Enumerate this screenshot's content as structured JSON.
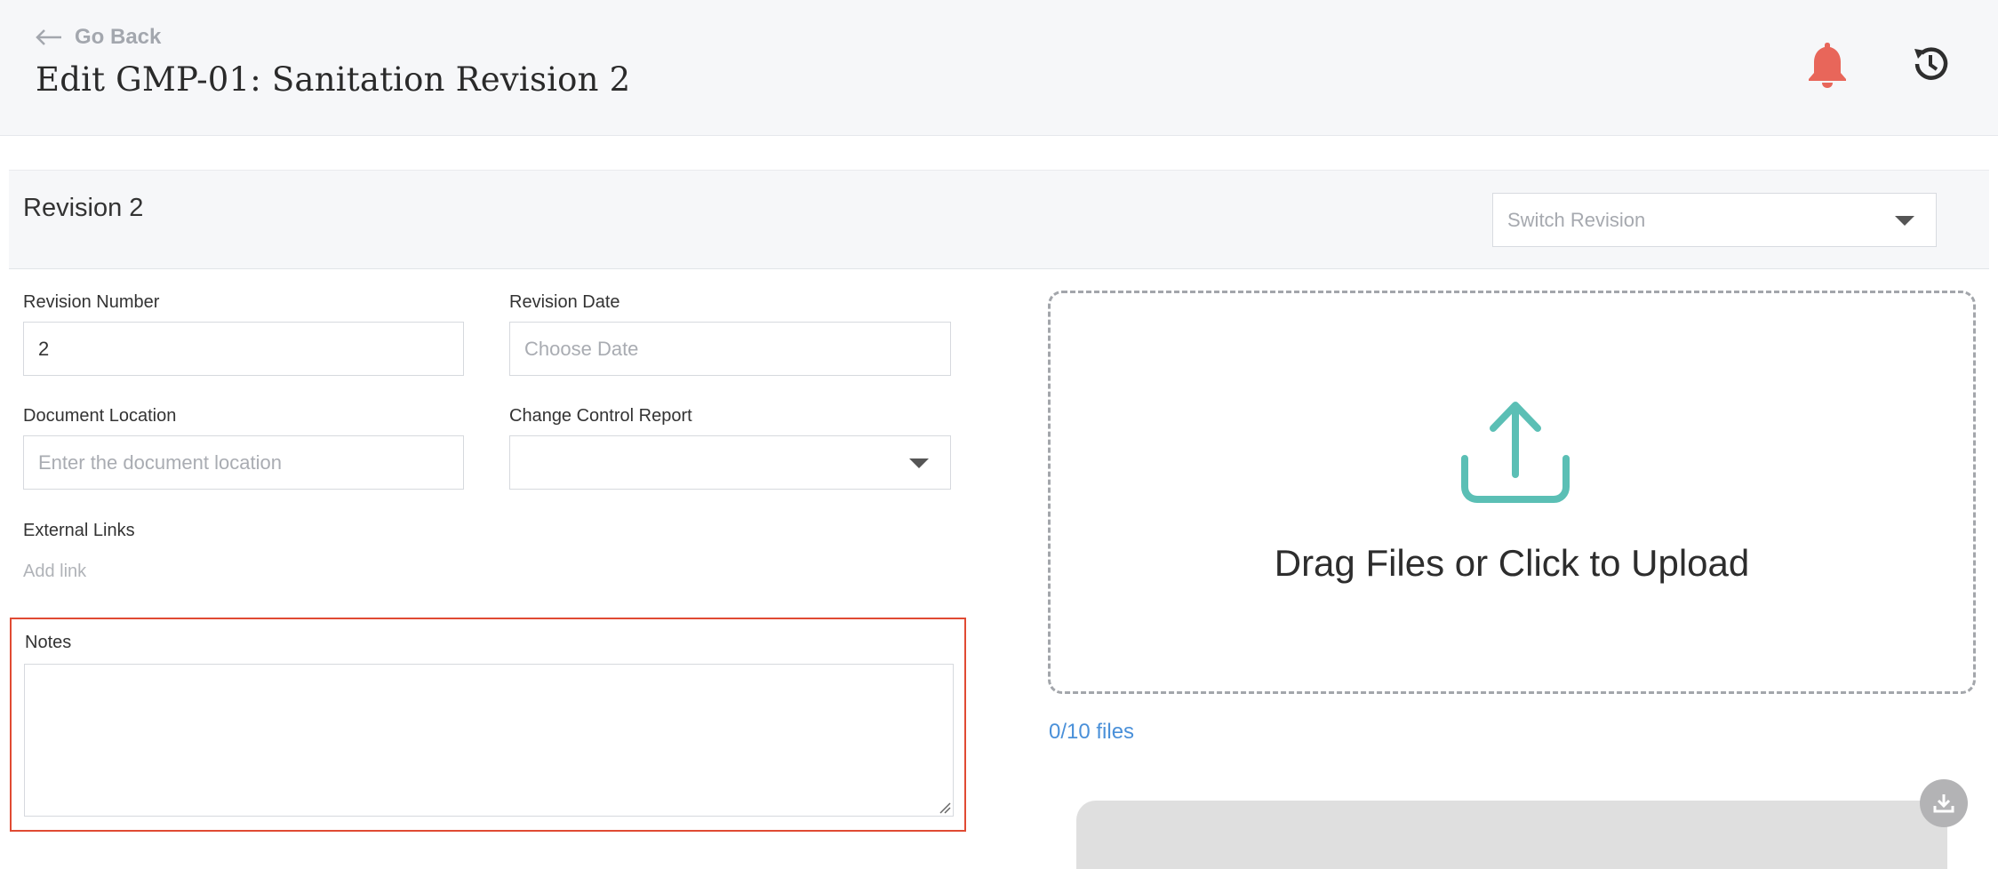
{
  "header": {
    "go_back_label": "Go Back",
    "title": "Edit GMP-01: Sanitation Revision 2",
    "bell_color": "#e8665a"
  },
  "revision": {
    "title": "Revision 2",
    "switch_placeholder": "Switch Revision"
  },
  "form": {
    "revision_number_label": "Revision Number",
    "revision_number_value": "2",
    "revision_date_label": "Revision Date",
    "revision_date_placeholder": "Choose Date",
    "document_location_label": "Document Location",
    "document_location_placeholder": "Enter the document location",
    "change_control_label": "Change Control Report",
    "change_control_value": "",
    "external_links_label": "External Links",
    "add_link_label": "Add link",
    "notes_label": "Notes",
    "notes_value": "",
    "highlight_color": "#e04a33"
  },
  "upload": {
    "drop_text": "Drag Files or Click to Upload",
    "file_count": "0/10 files",
    "accent_color": "#5bbfb5",
    "link_color": "#4a90d9"
  },
  "icons": {
    "back": "left-arrow-icon",
    "notifications": "bell-icon",
    "history": "history-icon",
    "upload": "upload-icon",
    "download": "download-icon",
    "dropdown": "caret-down-icon"
  }
}
